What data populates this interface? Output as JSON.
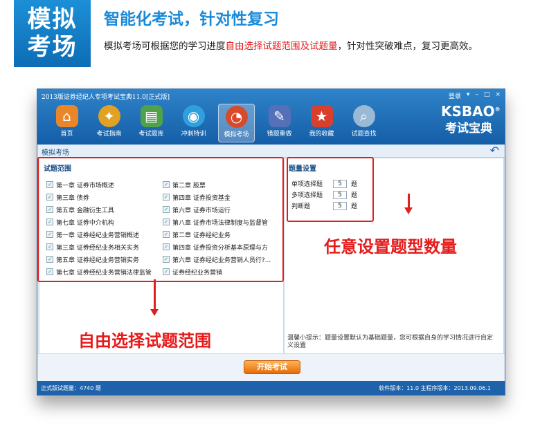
{
  "header": {
    "badge_line1": "模拟",
    "badge_line2": "考场",
    "title": "智能化考试，针对性复习",
    "desc_pre": "模拟考场可根据您的学习进度",
    "desc_highlight": "自由选择试题范围及试题量",
    "desc_post": "，针对性突破难点，复习更高效。"
  },
  "window": {
    "title": "2013版证券经纪人专项考试宝典11.0[正式版]",
    "controls": [
      "登录",
      "▾",
      "–",
      "□",
      "×"
    ],
    "brand_en": "KSBAO",
    "brand_reg": "®",
    "brand_cn": "考试宝典"
  },
  "nav": [
    {
      "label": "首页",
      "icon": "home-icon",
      "glyph": "⌂",
      "color": "#e9862a"
    },
    {
      "label": "考试指南",
      "icon": "compass-icon",
      "glyph": "✦",
      "color": "#e1a123"
    },
    {
      "label": "考试题库",
      "icon": "books-icon",
      "glyph": "▤",
      "color": "#4fa24a"
    },
    {
      "label": "冲刺特训",
      "icon": "globe-icon",
      "glyph": "◉",
      "color": "#2fa0dd"
    },
    {
      "label": "模拟考场",
      "icon": "clock-icon",
      "glyph": "◔",
      "color": "#d94a2a"
    },
    {
      "label": "错题重做",
      "icon": "pen-icon",
      "glyph": "✎",
      "color": "#5470b8"
    },
    {
      "label": "我的收藏",
      "icon": "star-icon",
      "glyph": "★",
      "color": "#d8402d"
    },
    {
      "label": "试题查找",
      "icon": "magnifier-icon",
      "glyph": "⌕",
      "color": "#9ab9d4"
    }
  ],
  "sub": {
    "title": "模拟考场"
  },
  "range": {
    "title": "试题范围",
    "items": [
      "第一章 证券市场概述",
      "第二章 股票",
      "第三章 债券",
      "第四章 证券投资基金",
      "第五章 金融衍生工具",
      "第六章 证券市场运行",
      "第七章 证券中介机构",
      "第八章 证券市场法律制度与监督管",
      "第一章 证券经纪业务营销概述",
      "第二章 证券经纪业务",
      "第三章 证券经纪业务相关实务",
      "第四章 证券投资分析基本原理与方",
      "第五章 证券经纪业务营销实务",
      "第六章 证券经纪业务营销人员行?...",
      "第七章 证券经纪业务营销法律监管",
      "证券经纪业务营销"
    ]
  },
  "qty": {
    "title": "题量设置",
    "rows": [
      {
        "label": "单项选择题",
        "value": "5",
        "unit": "题"
      },
      {
        "label": "多项选择题",
        "value": "5",
        "unit": "题"
      },
      {
        "label": "判断题",
        "value": "5",
        "unit": "题"
      }
    ],
    "tip": "温馨小提示：题量设置默认为基础题量，您可根据自身的学习情况进行自定义设置"
  },
  "start_button": "开始考试",
  "status": {
    "left": "正式版试题量：4740 题",
    "right": "软件版本：11.0 主程序版本：2013.09.06.1"
  },
  "annotations": {
    "qty": "任意设置题型数量",
    "range": "自由选择试题范围"
  }
}
